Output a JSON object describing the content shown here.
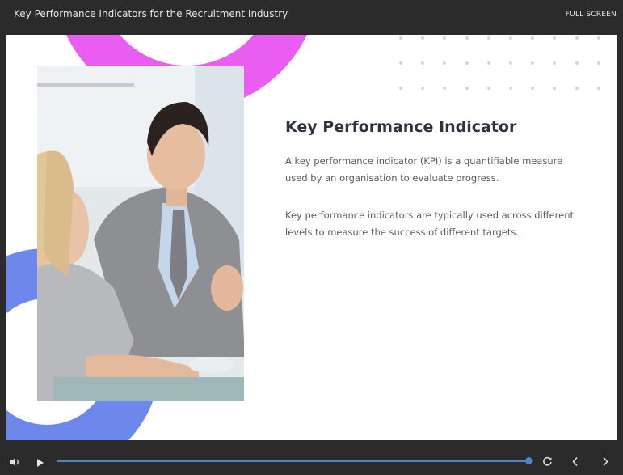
{
  "window": {
    "title": "Key Performance Indicators for the Recruitment Industry",
    "fullscreen_label": "FULL SCREEN"
  },
  "slide": {
    "heading": "Key Performance Indicator",
    "paragraphs": [
      "A key performance indicator (KPI) is a quantifiable measure used by an organisation to evaluate progress.",
      "Key performance indicators are typically used across different levels to measure the success of different targets."
    ]
  },
  "player": {
    "progress": 0.99,
    "icons": [
      "volume-icon",
      "play-icon",
      "replay-icon",
      "chevron-left-icon",
      "chevron-right-icon"
    ]
  },
  "colors": {
    "accent_pink": "#e95df0",
    "accent_blue": "#6e87ec",
    "progress": "#4f86c6",
    "chrome": "#2b2b2b"
  }
}
